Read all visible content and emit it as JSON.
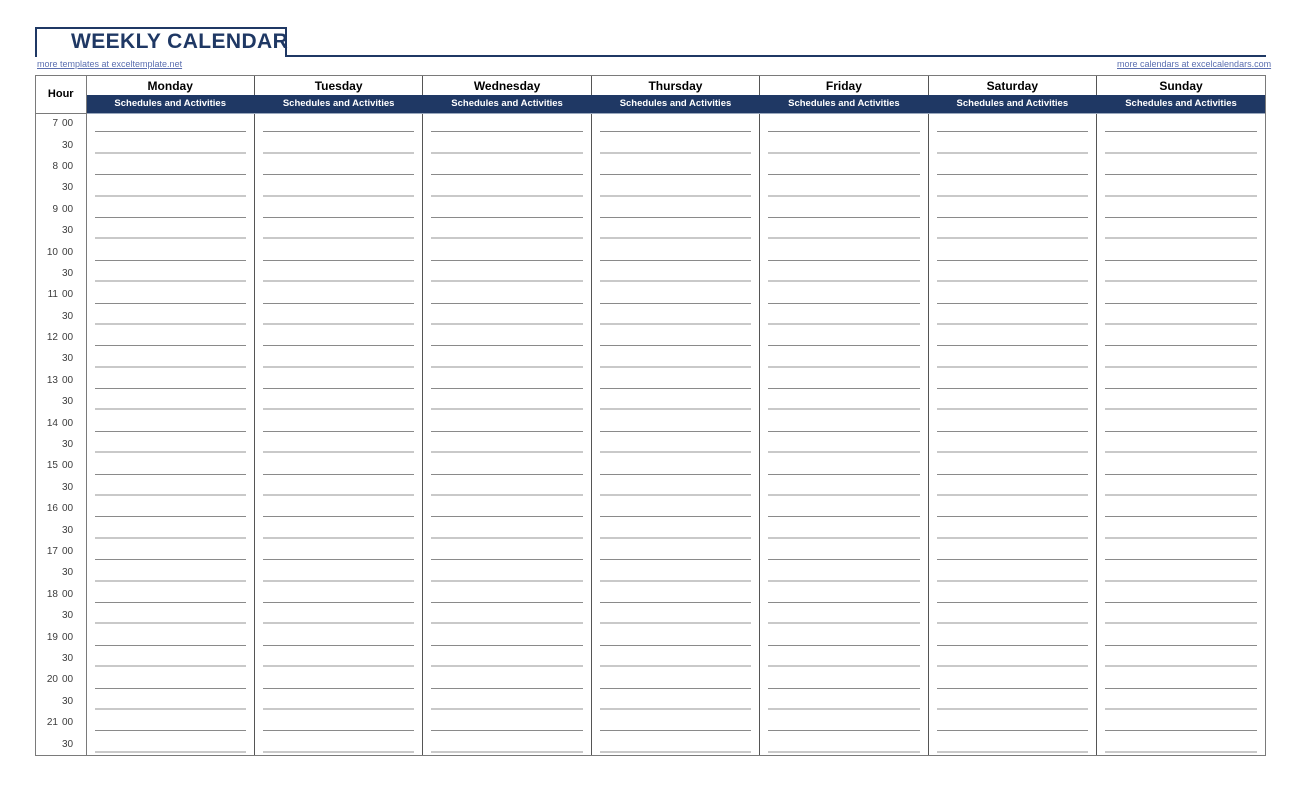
{
  "title": "WEEKLY CALENDAR",
  "links": {
    "left": "more templates at exceltemplate.net",
    "right": "more calendars at excelcalendars.com"
  },
  "table": {
    "hour_header": "Hour",
    "days": [
      "Monday",
      "Tuesday",
      "Wednesday",
      "Thursday",
      "Friday",
      "Saturday",
      "Sunday"
    ],
    "subheader_label": "Schedules and Activities",
    "rows": [
      {
        "hour": "7",
        "minute": "00"
      },
      {
        "hour": "",
        "minute": "30"
      },
      {
        "hour": "8",
        "minute": "00"
      },
      {
        "hour": "",
        "minute": "30"
      },
      {
        "hour": "9",
        "minute": "00"
      },
      {
        "hour": "",
        "minute": "30"
      },
      {
        "hour": "10",
        "minute": "00"
      },
      {
        "hour": "",
        "minute": "30"
      },
      {
        "hour": "11",
        "minute": "00"
      },
      {
        "hour": "",
        "minute": "30"
      },
      {
        "hour": "12",
        "minute": "00"
      },
      {
        "hour": "",
        "minute": "30"
      },
      {
        "hour": "13",
        "minute": "00"
      },
      {
        "hour": "",
        "minute": "30"
      },
      {
        "hour": "14",
        "minute": "00"
      },
      {
        "hour": "",
        "minute": "30"
      },
      {
        "hour": "15",
        "minute": "00"
      },
      {
        "hour": "",
        "minute": "30"
      },
      {
        "hour": "16",
        "minute": "00"
      },
      {
        "hour": "",
        "minute": "30"
      },
      {
        "hour": "17",
        "minute": "00"
      },
      {
        "hour": "",
        "minute": "30"
      },
      {
        "hour": "18",
        "minute": "00"
      },
      {
        "hour": "",
        "minute": "30"
      },
      {
        "hour": "19",
        "minute": "00"
      },
      {
        "hour": "",
        "minute": "30"
      },
      {
        "hour": "20",
        "minute": "00"
      },
      {
        "hour": "",
        "minute": "30"
      },
      {
        "hour": "21",
        "minute": "00"
      },
      {
        "hour": "",
        "minute": "30"
      }
    ]
  },
  "colors": {
    "navy": "#1F3864",
    "link": "#5B6FB0",
    "grid": "#7a7a7a",
    "writeline": "#8a8a8a",
    "hourline": "#c9c9c9"
  }
}
